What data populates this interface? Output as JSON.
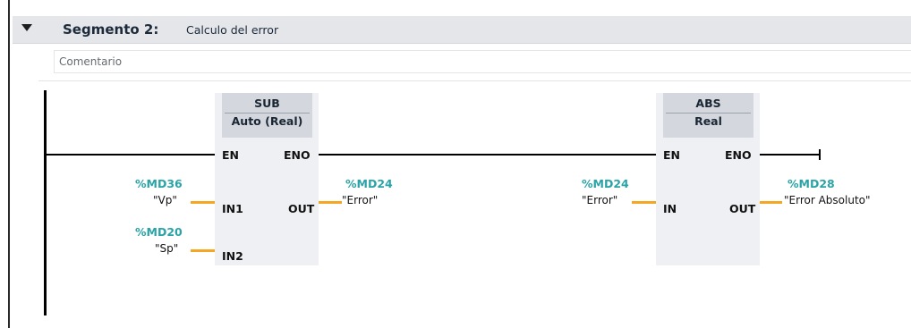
{
  "segment": {
    "title": "Segmento 2:",
    "description": "Calculo del error",
    "comment_placeholder": "Comentario"
  },
  "blocks": {
    "sub": {
      "name": "SUB",
      "type": "Auto (Real)",
      "pins": {
        "en": "EN",
        "eno": "ENO",
        "in1": "IN1",
        "in2": "IN2",
        "out": "OUT"
      },
      "operands": {
        "in1": {
          "address": "%MD36",
          "tag": "\"Vp\""
        },
        "in2": {
          "address": "%MD20",
          "tag": "\"Sp\""
        },
        "out": {
          "address": "%MD24",
          "tag": "\"Error\""
        }
      }
    },
    "abs": {
      "name": "ABS",
      "type": "Real",
      "pins": {
        "en": "EN",
        "eno": "ENO",
        "in": "IN",
        "out": "OUT"
      },
      "operands": {
        "in": {
          "address": "%MD24",
          "tag": "\"Error\""
        },
        "out": {
          "address": "%MD28",
          "tag": "\"Error Absoluto\""
        }
      }
    }
  },
  "colors": {
    "address": "#2aa3a7",
    "wire": "#f5a623",
    "block": "#eef0f3",
    "header": "#d4d8de"
  },
  "icons": {
    "collapse": "triangle-down-icon"
  }
}
